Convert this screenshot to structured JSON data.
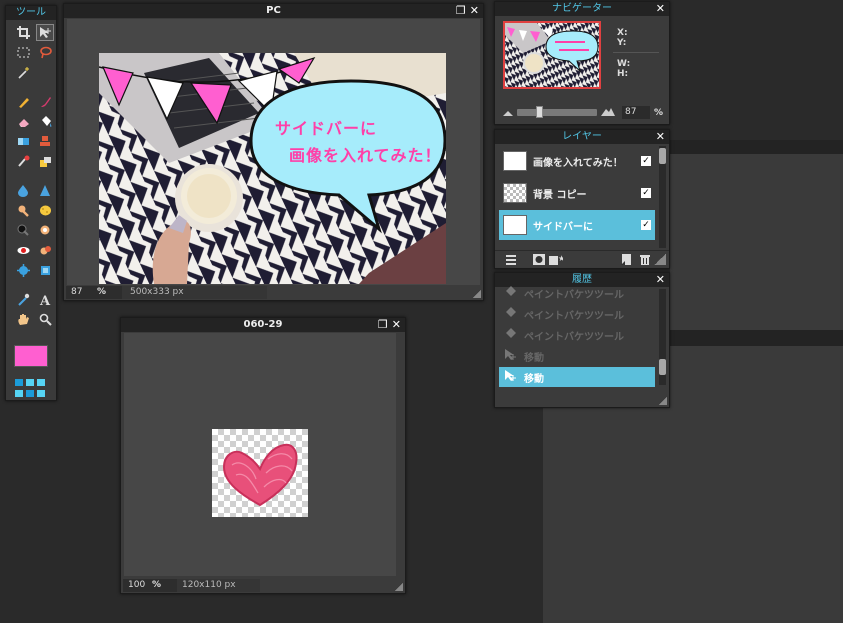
{
  "tools_panel": {
    "title": "ツール",
    "tools": [
      "crop-icon",
      "move-icon",
      "marquee-icon",
      "lasso-icon",
      "magic-wand-icon",
      "",
      "pencil-icon",
      "brush-icon",
      "eraser-icon",
      "paint-bucket-icon",
      "gradient-icon",
      "clone-stamp-icon",
      "color-replace-icon",
      "drawing-icon",
      "blur-icon",
      "sharpen-icon",
      "smudge-icon",
      "sponge-icon",
      "burn-icon",
      "dodge-icon",
      "red-eye-icon",
      "spot-heal-icon",
      "bloat-icon",
      "pinch-icon",
      "color-picker-icon",
      "type-icon",
      "hand-icon",
      "zoom-icon"
    ],
    "fg_color": "#ff5fd0"
  },
  "doc_pc": {
    "title": "PC",
    "zoom": "87",
    "pct": "%",
    "size": "500x333 px",
    "bubble_line1": "サイドバーに",
    "bubble_line2": "画像を入れてみた！"
  },
  "doc_heart": {
    "title": "060-29",
    "zoom": "100",
    "pct": "%",
    "size": "120x110 px"
  },
  "navigator": {
    "title": "ナビゲーター",
    "x_label": "X:",
    "y_label": "Y:",
    "w_label": "W:",
    "h_label": "H:",
    "zoom_value": "87",
    "pct": "%",
    "zoom_level": 0.87
  },
  "layers": {
    "title": "レイヤー",
    "items": [
      {
        "name": "画像を入れてみた！",
        "visible": true,
        "selected": false
      },
      {
        "name": "背景 コピー",
        "visible": true,
        "selected": false
      },
      {
        "name": "サイドバーに",
        "visible": true,
        "selected": true
      }
    ]
  },
  "history": {
    "title": "履歴",
    "items": [
      {
        "name": "ペイントバケツツール",
        "selected": false
      },
      {
        "name": "ペイントバケツツール",
        "selected": false
      },
      {
        "name": "ペイントバケツツール",
        "selected": false
      },
      {
        "name": "移動",
        "selected": false
      },
      {
        "name": "移動",
        "selected": true
      }
    ]
  },
  "colors": {
    "accent": "#5bbfdb",
    "title_cyan": "#52c6e6",
    "pink": "#ff5fd0",
    "bubble": "#a6ecfb"
  }
}
